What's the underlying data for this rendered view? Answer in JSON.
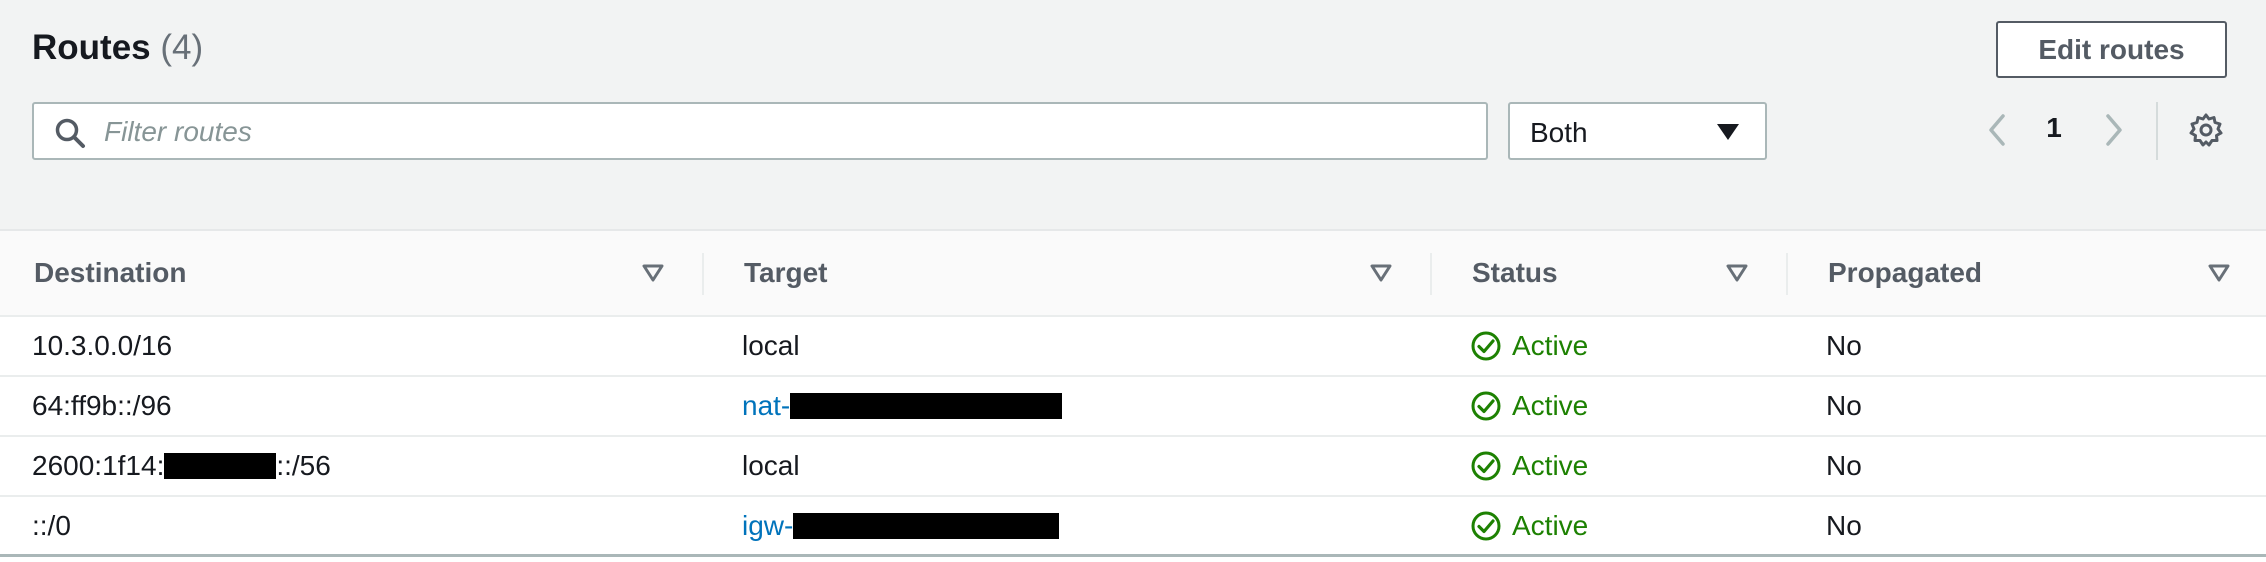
{
  "header": {
    "title": "Routes",
    "count": "(4)",
    "edit_button": "Edit routes",
    "search_placeholder": "Filter routes",
    "filter_select_value": "Both",
    "page_number": "1"
  },
  "columns": [
    "Destination",
    "Target",
    "Status",
    "Propagated"
  ],
  "rows": [
    {
      "destination": "10.3.0.0/16",
      "target": "local",
      "target_is_link": false,
      "status": "Active",
      "propagated": "No"
    },
    {
      "destination": "64:ff9b::/96",
      "target_prefix": "nat-",
      "target_is_link": true,
      "status": "Active",
      "propagated": "No"
    },
    {
      "destination_prefix": "2600:1f14:",
      "destination_suffix": "::/56",
      "target": "local",
      "target_is_link": false,
      "status": "Active",
      "propagated": "No"
    },
    {
      "destination": "::/0",
      "target_prefix": "igw-",
      "target_is_link": true,
      "status": "Active",
      "propagated": "No"
    }
  ],
  "colors": {
    "header_bg": "#f2f3f3",
    "link": "#0073bb",
    "status_active": "#1d8102",
    "text": "#16191f",
    "muted": "#545b64"
  },
  "icons": {
    "search": "search-icon",
    "caret": "caret-down-icon",
    "prev": "chevron-left-icon",
    "next": "chevron-right-icon",
    "settings": "gear-icon",
    "sort": "sort-caret-icon",
    "status": "check-circle-icon"
  }
}
